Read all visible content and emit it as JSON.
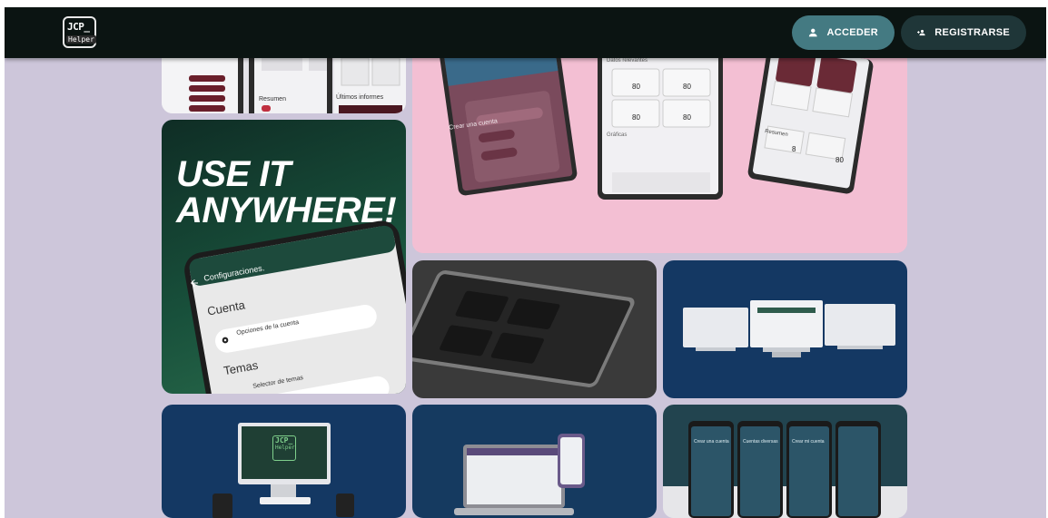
{
  "header": {
    "logo_line1": "JCP_",
    "logo_line2": "Helper",
    "login_label": "ACCEDER",
    "register_label": "REGISTRARSE"
  },
  "gallery": {
    "top_left_card": {
      "section_summary": "Resumen",
      "section_reports": "Últimos informes"
    },
    "pink_card": {
      "tablet_left_heading": "Crear una cuenta",
      "tablet_middle_heading": "Datos relevantes",
      "tablet_middle_values": [
        "80",
        "80",
        "80",
        "80"
      ],
      "tablet_middle_section": "Gráficas",
      "tablet_right_heading": "Resumen",
      "tablet_right_values": [
        "8",
        "80"
      ]
    },
    "green_card": {
      "headline_line1": "USE IT",
      "headline_line2": "ANYWHERE!",
      "screen_title": "Configuraciones.",
      "section_account": "Cuenta",
      "account_option": "Opciones de la cuenta",
      "section_themes": "Temas",
      "themes_option": "Selector de temas"
    },
    "blue2_card": {
      "monitor_logo_line1": "JCP_",
      "monitor_logo_line2": "Helper"
    },
    "phones_card": {
      "phone_headings": [
        "Crear una cuenta",
        "Cuentas diversas",
        "Crear mi cuenta",
        ""
      ]
    }
  },
  "colors": {
    "background": "#cdc6da",
    "topbar": "#0b1412",
    "login_button": "#447a82",
    "register_button": "#1f3638",
    "pink_card": "#f3bfd3",
    "navy_card": "#143863",
    "green_card": "#18503b"
  },
  "icons": {
    "login": "person-icon",
    "register": "person-add-icon",
    "back": "arrow-back-icon",
    "settings": "gear-icon"
  }
}
